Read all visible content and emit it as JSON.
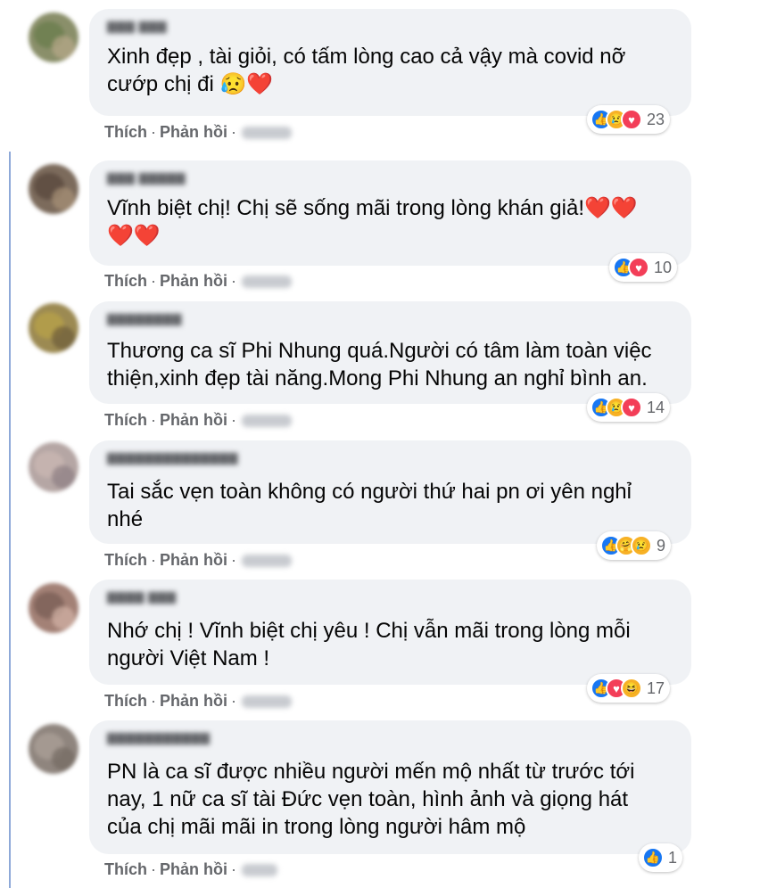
{
  "comments": [
    {
      "lines": [
        "Xinh đẹp , tài giỏi, có tấm lòng cao cả vậy mà covid nỡ",
        "cướp chị đi 😥❤️"
      ],
      "actions": {
        "like": "Thích",
        "reply": "Phản hồi"
      },
      "reactions": {
        "icons": [
          "like-icon",
          "sad-icon",
          "love-icon"
        ],
        "count": "23"
      },
      "avatar_colors": [
        "#6a7d4d",
        "#b8a88a"
      ]
    },
    {
      "lines": [
        "Vĩnh biệt chị! Chị sẽ sống mãi trong lòng khán giả!❤️❤️",
        "❤️❤️"
      ],
      "actions": {
        "like": "Thích",
        "reply": "Phản hồi"
      },
      "reactions": {
        "icons": [
          "like-icon",
          "love-icon"
        ],
        "count": "10"
      },
      "avatar_colors": [
        "#5a4a3e",
        "#a89278"
      ]
    },
    {
      "lines": [
        "Thương ca sĩ Phi Nhung quá.Người có tâm làm toàn việc",
        "thiện,xinh đẹp tài năng.Mong Phi Nhung an nghỉ bình an."
      ],
      "actions": {
        "like": "Thích",
        "reply": "Phản hồi"
      },
      "reactions": {
        "icons": [
          "like-icon",
          "sad-icon",
          "love-icon"
        ],
        "count": "14"
      },
      "avatar_colors": [
        "#b7a04a",
        "#6e5d3a"
      ]
    },
    {
      "lines": [
        "Tai sắc vẹn toàn không có người thứ hai pn ơi yên nghỉ",
        "nhé"
      ],
      "actions": {
        "like": "Thích",
        "reply": "Phản hồi"
      },
      "reactions": {
        "icons": [
          "like-icon",
          "care-icon",
          "sad-icon"
        ],
        "count": "9"
      },
      "avatar_colors": [
        "#c9b6b1",
        "#8d7f83"
      ]
    },
    {
      "lines": [
        "Nhớ chị ! Vĩnh biệt chị yêu ! Chị vẫn mãi trong lòng mỗi",
        "người Việt Nam !"
      ],
      "actions": {
        "like": "Thích",
        "reply": "Phản hồi"
      },
      "reactions": {
        "icons": [
          "like-icon",
          "love-icon",
          "haha-icon"
        ],
        "count": "17"
      },
      "avatar_colors": [
        "#7b5f58",
        "#d3b4a6"
      ]
    },
    {
      "lines": [
        "PN là ca sĩ được nhiều người mến mộ nhất từ trước tới",
        "nay, 1 nữ ca sĩ tài Đức vẹn toàn, hình ảnh và giọng hát",
        "của chị mãi mãi in trong lòng người hâm mộ"
      ],
      "actions": {
        "like": "Thích",
        "reply": "Phản hồi"
      },
      "reactions": {
        "icons": [
          "like-icon"
        ],
        "count": "1"
      },
      "avatar_colors": [
        "#a99e96",
        "#746a63"
      ]
    }
  ]
}
